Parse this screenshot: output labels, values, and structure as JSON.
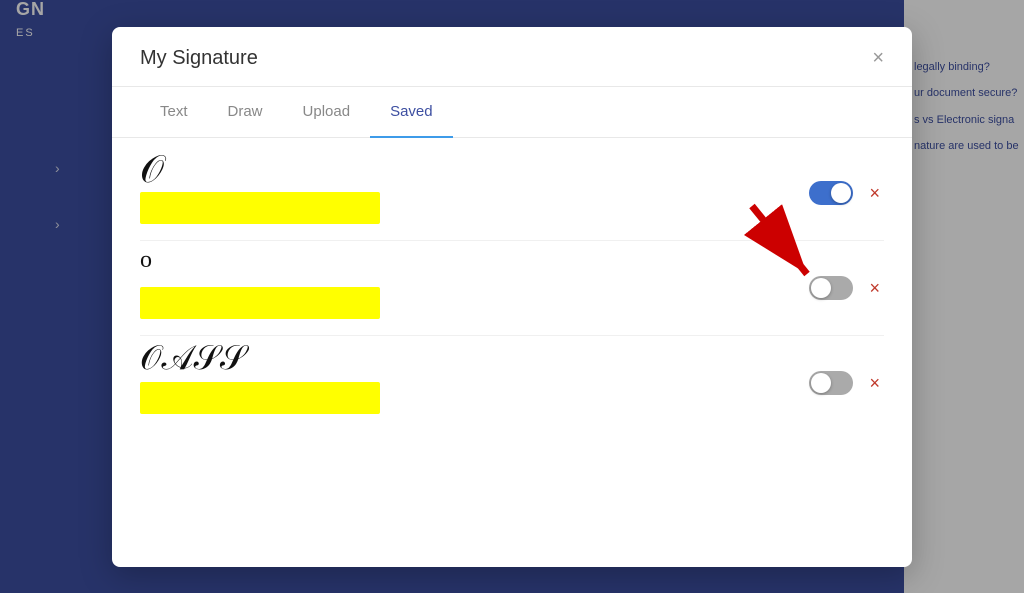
{
  "app": {
    "logo": "GN",
    "subtitle": "ES"
  },
  "modal": {
    "title": "My Signature",
    "close_label": "×",
    "tabs": [
      {
        "id": "text",
        "label": "Text",
        "active": false
      },
      {
        "id": "draw",
        "label": "Draw",
        "active": false
      },
      {
        "id": "upload",
        "label": "Upload",
        "active": false
      },
      {
        "id": "saved",
        "label": "Saved",
        "active": true
      }
    ],
    "signatures": [
      {
        "id": 1,
        "enabled": true,
        "toggle_state": "on"
      },
      {
        "id": 2,
        "enabled": false,
        "toggle_state": "off"
      },
      {
        "id": 3,
        "enabled": false,
        "toggle_state": "off"
      }
    ],
    "delete_label": "×"
  },
  "bg_links": [
    "legally binding?",
    "ur document secure?",
    "s vs Electronic signa",
    "nature are used to be"
  ]
}
